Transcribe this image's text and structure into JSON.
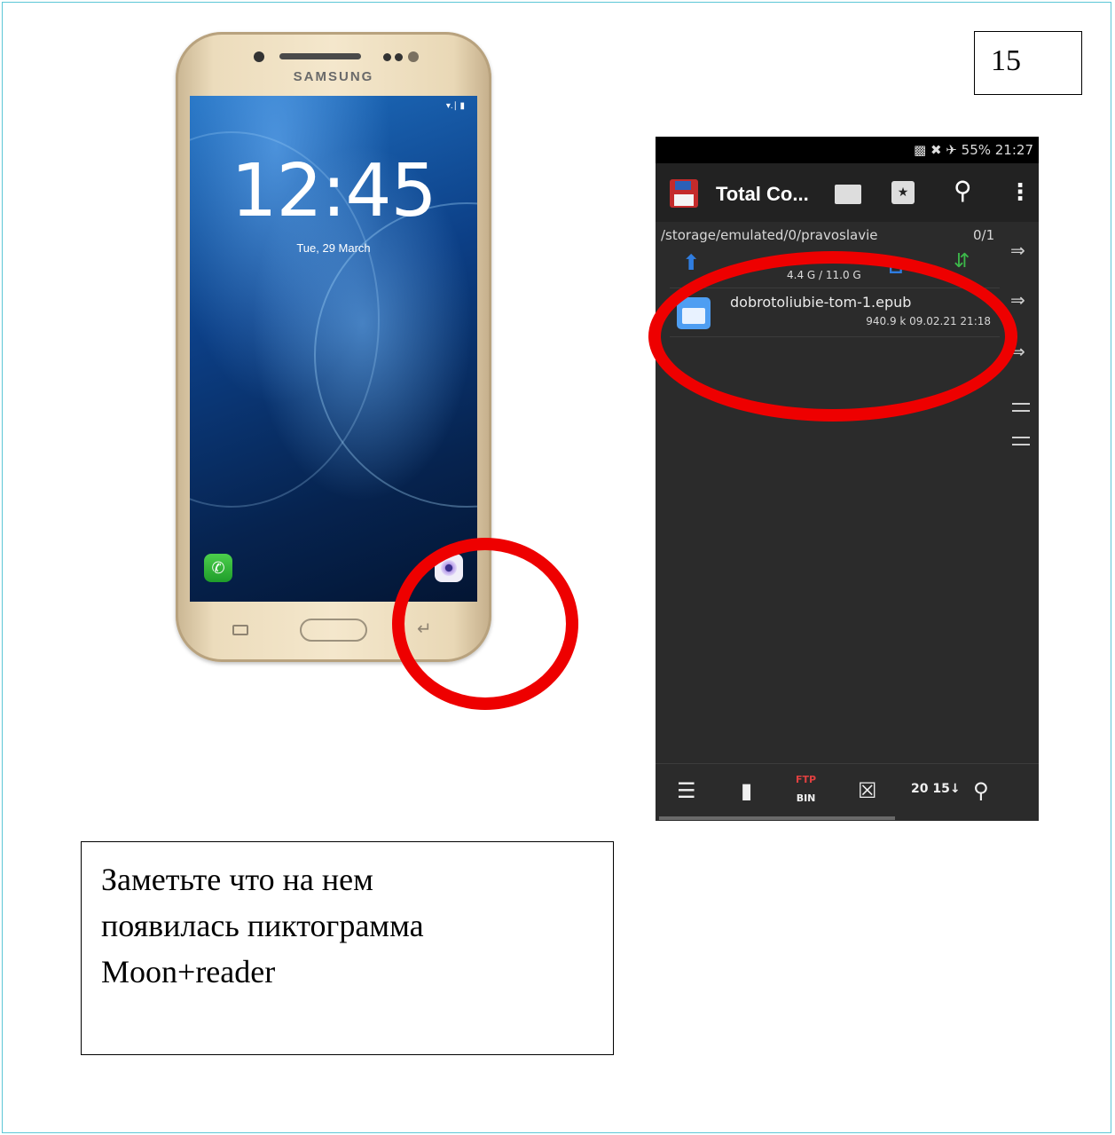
{
  "page": {
    "number": "15"
  },
  "phone": {
    "brand": "SAMSUNG",
    "clock": "12:45",
    "date": "Tue, 29 March"
  },
  "total_commander": {
    "status_bar": "55% 21:27",
    "app_title": "Total Co...",
    "path": "/storage/emulated/0/pravoslavie",
    "selection_count": "0/1",
    "storage": "4.4 G / 11.0 G",
    "file": {
      "name": "dobrotoliubie-tom-1.epub",
      "meta": "940.9 k  09.02.21  21:18"
    },
    "toolbar": {
      "ftp_top": "FTP",
      "ftp_bottom": "BIN",
      "sort": "20 15"
    }
  },
  "note": {
    "lines": [
      "Заметьте что  на нем",
      "появилась пиктограмма",
      "Moon+reader"
    ]
  },
  "colors": {
    "highlight": "#ee0000",
    "frame": "#5cc6d6",
    "tc_background": "#2b2b2b"
  }
}
